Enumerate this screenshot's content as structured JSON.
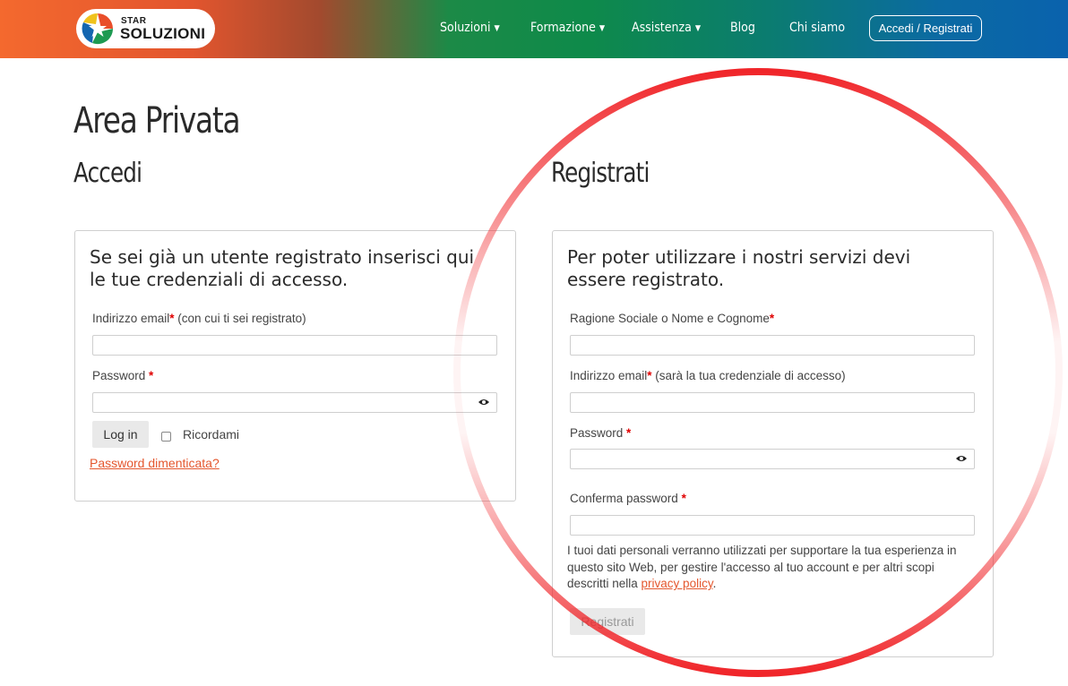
{
  "header": {
    "logo_small": "STAR",
    "logo_big": "SOLUZIONI",
    "nav": [
      {
        "label": "Soluzioni",
        "dropdown": true
      },
      {
        "label": "Formazione",
        "dropdown": true
      },
      {
        "label": "Assistenza",
        "dropdown": true
      },
      {
        "label": "Blog",
        "dropdown": false
      },
      {
        "label": "Chi siamo",
        "dropdown": false
      }
    ],
    "cta": "Accedi / Registrati"
  },
  "page": {
    "title": "Area Privata"
  },
  "login": {
    "heading": "Accedi",
    "intro": "Se sei già un utente registrato inserisci qui le tue credenziali di accesso.",
    "email_label": "Indirizzo email",
    "email_hint": " (con cui ti sei registrato)",
    "password_label": "Password ",
    "button": "Log in",
    "remember": "Ricordami",
    "forgot": "Password dimenticata?"
  },
  "register": {
    "heading": "Registrati",
    "intro": "Per poter utilizzare i nostri servizi devi essere registrato.",
    "name_label": "Ragione Sociale o Nome e Cognome",
    "email_label": "Indirizzo email",
    "email_hint": " (sarà la tua credenziale di accesso)",
    "password_label": "Password ",
    "confirm_label": "Conferma password ",
    "privacy_text": "I tuoi dati personali verranno utilizzati per supportare la tua esperienza in questo sito Web, per gestire l'accesso al tuo account e per altri scopi descritti nella ",
    "privacy_link": "privacy policy",
    "privacy_end": ".",
    "button": "Registrati"
  },
  "required_mark": "*",
  "colors": {
    "accent_link": "#e4572e",
    "required": "#e00000",
    "annotation": "#f0262a"
  }
}
